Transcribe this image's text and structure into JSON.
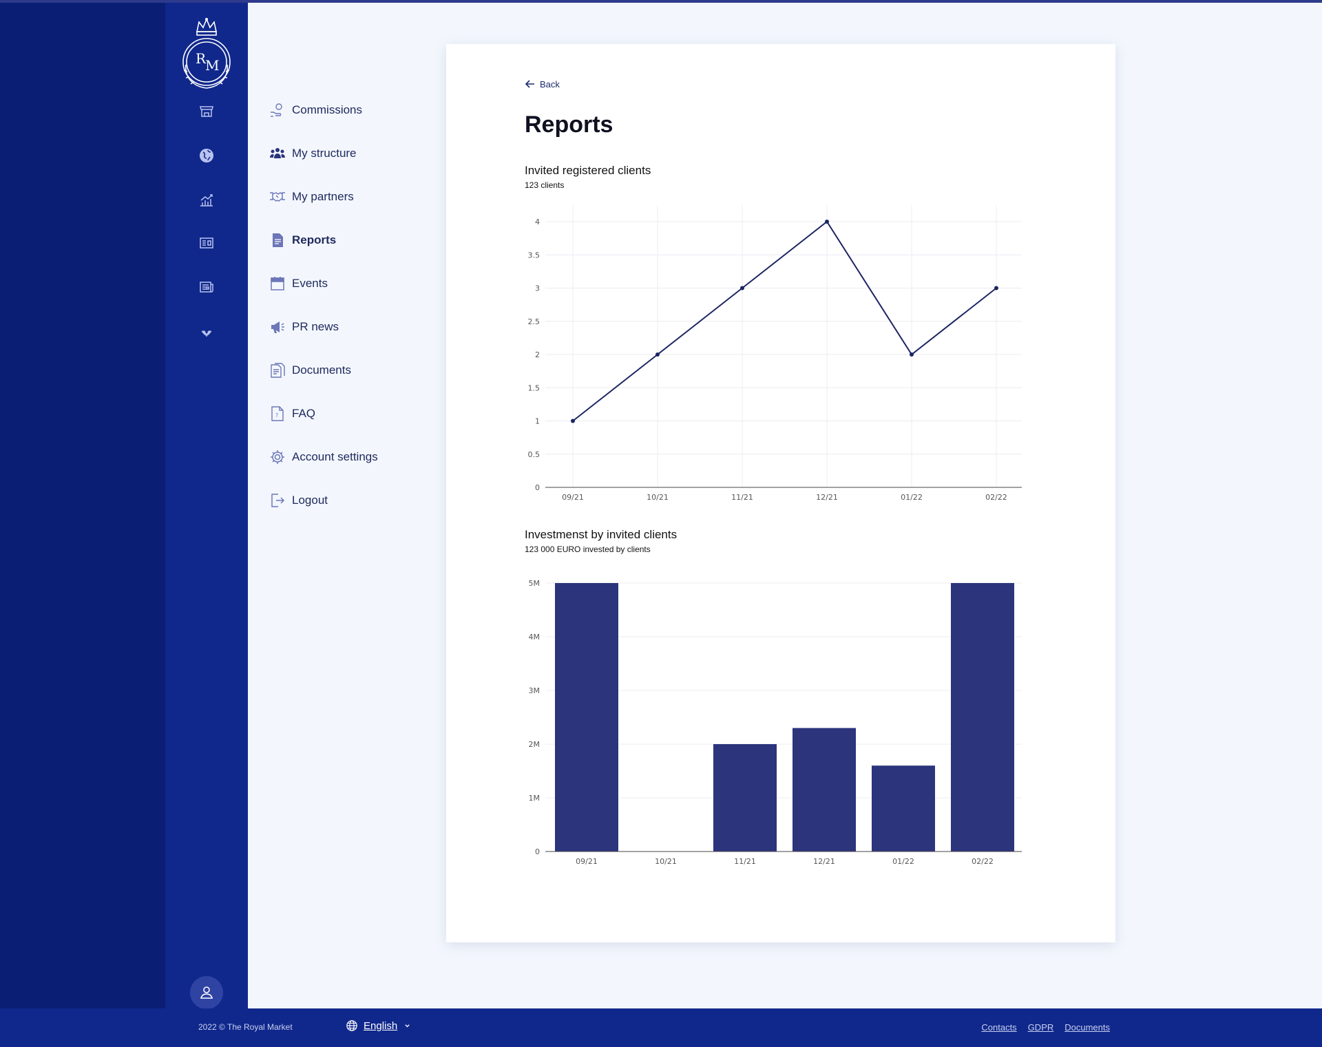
{
  "colors": {
    "accent": "#2c347c",
    "panel_dark": "#0a1f73",
    "rail": "#10288c",
    "background": "#f3f7fd",
    "card": "#ffffff"
  },
  "rail_icons": [
    "store-icon",
    "globe-icon",
    "growth-chart-icon",
    "news-card-icon",
    "newspaper-icon",
    "laurel-icon"
  ],
  "nav": {
    "items": [
      {
        "label": "Commissions",
        "icon": "coins-hand-icon"
      },
      {
        "label": "My structure",
        "icon": "team-icon"
      },
      {
        "label": "My partners",
        "icon": "handshake-icon"
      },
      {
        "label": "Reports",
        "icon": "report-document-icon",
        "active": true
      },
      {
        "label": "Events",
        "icon": "calendar-icon"
      },
      {
        "label": "PR news",
        "icon": "megaphone-icon"
      },
      {
        "label": "Documents",
        "icon": "documents-icon"
      },
      {
        "label": "FAQ",
        "icon": "faq-icon"
      },
      {
        "label": "Account settings",
        "icon": "gear-icon"
      },
      {
        "label": "Logout",
        "icon": "logout-icon"
      }
    ]
  },
  "main": {
    "back_label": "Back",
    "title": "Reports"
  },
  "chart_data": [
    {
      "type": "line",
      "title": "Invited registered clients",
      "subtitle": "123 clients",
      "categories": [
        "09/21",
        "10/21",
        "11/21",
        "12/21",
        "01/22",
        "02/22"
      ],
      "values": [
        1,
        2,
        3,
        4,
        2,
        3
      ],
      "ylim": [
        0,
        4
      ],
      "yticks": [
        0,
        0.5,
        1,
        1.5,
        2,
        2.5,
        3,
        3.5,
        4
      ],
      "ytick_labels": [
        "0",
        "0.5",
        "1",
        "1.5",
        "2",
        "2.5",
        "3",
        "3.5",
        "4"
      ],
      "grid": true,
      "color": "#1c2563"
    },
    {
      "type": "bar",
      "title": "Investmenst by invited clients",
      "subtitle": "123 000 EURO invested by clients",
      "categories": [
        "09/21",
        "10/21",
        "11/21",
        "12/21",
        "01/22",
        "02/22"
      ],
      "values": [
        5000000,
        0,
        2000000,
        2300000,
        1600000,
        5000000
      ],
      "ylim": [
        0,
        5000000
      ],
      "yticks": [
        0,
        1000000,
        2000000,
        3000000,
        4000000,
        5000000
      ],
      "ytick_labels": [
        "0",
        "1M",
        "2M",
        "3M",
        "4M",
        "5M"
      ],
      "grid": true,
      "color": "#2c347c"
    }
  ],
  "footer": {
    "copyright": "2022 © The Royal Market",
    "language": "English",
    "links": [
      "Contacts",
      "GDPR",
      "Documents"
    ]
  }
}
